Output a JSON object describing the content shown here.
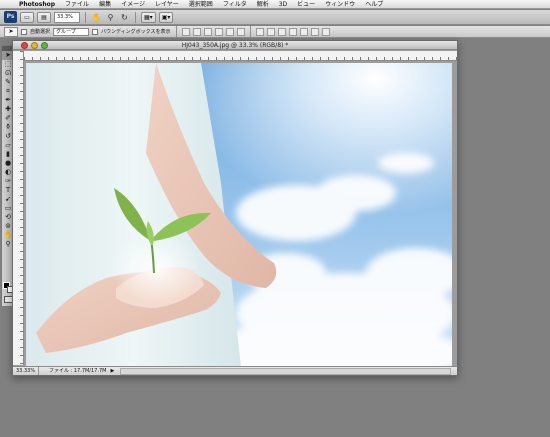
{
  "menubar": {
    "apple": "",
    "app_name": "Photoshop",
    "items": [
      "ファイル",
      "編集",
      "イメージ",
      "レイヤー",
      "選択範囲",
      "フィルタ",
      "解析",
      "3D",
      "ビュー",
      "ウィンドウ",
      "ヘルプ"
    ]
  },
  "appbar": {
    "logo": "Ps",
    "zoom": "33.3%"
  },
  "optionsbar": {
    "auto_select_label": "自動選択",
    "auto_select_target": "グループ",
    "bounding_box_label": "バウンディングボックスを表示"
  },
  "document": {
    "title": "HJ043_350A.jpg @ 33.3% (RGB/8) *",
    "status_zoom": "33.33%",
    "status_info": "ファイル : 17.7M/17.7M"
  },
  "colors": {
    "foreground": "#000000",
    "background": "#ffffff"
  }
}
